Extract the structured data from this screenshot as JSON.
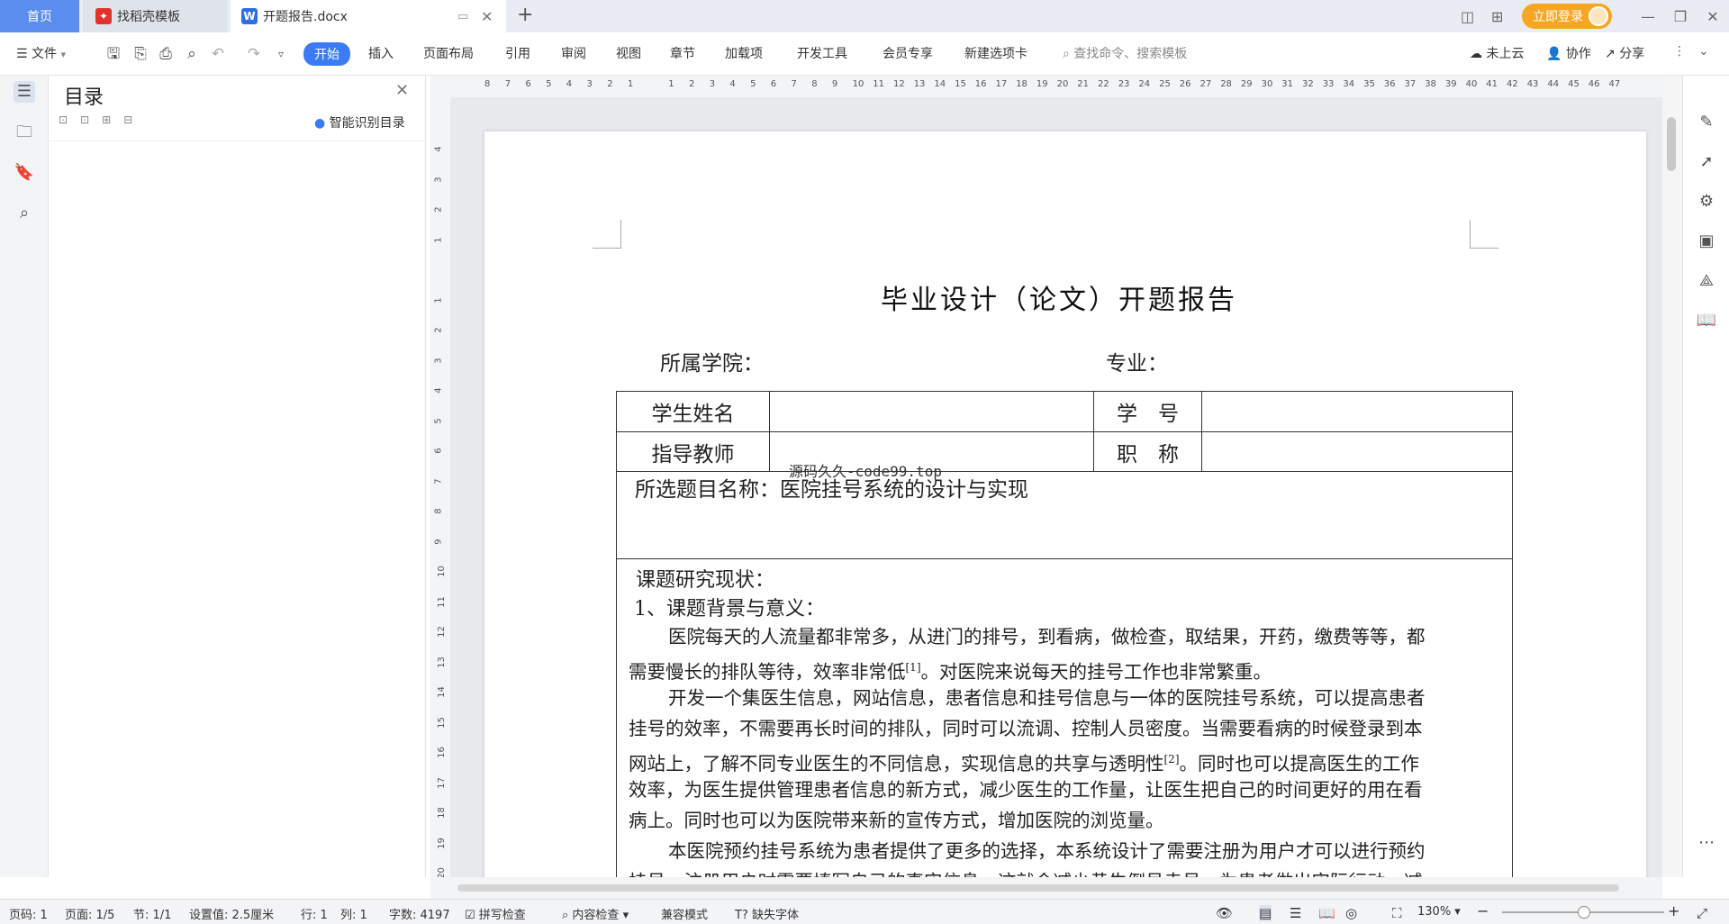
{
  "tabs": {
    "home": "首页",
    "templates": "找稻壳模板",
    "document": "开题报告.docx"
  },
  "titlebar": {
    "login": "立即登录"
  },
  "menu": {
    "file": "文件",
    "items": [
      "开始",
      "插入",
      "页面布局",
      "引用",
      "审阅",
      "视图",
      "章节",
      "加载项",
      "开发工具",
      "会员专享",
      "新建选项卡"
    ],
    "search_placeholder": "查找命令、搜索模板",
    "cloud": "未上云",
    "collab": "协作",
    "share": "分享"
  },
  "toc": {
    "title": "目录",
    "smart": "智能识别目录"
  },
  "ruler": {
    "h_ticks": [
      "8",
      "7",
      "6",
      "5",
      "4",
      "3",
      "2",
      "1",
      "",
      "1",
      "2",
      "3",
      "4",
      "5",
      "6",
      "7",
      "8",
      "9",
      "10",
      "11",
      "12",
      "13",
      "14",
      "15",
      "16",
      "17",
      "18",
      "19",
      "20",
      "21",
      "22",
      "23",
      "24",
      "25",
      "26",
      "27",
      "28",
      "29",
      "30",
      "31",
      "32",
      "33",
      "34",
      "35",
      "36",
      "37",
      "38",
      "39",
      "40",
      "41",
      "42",
      "43",
      "44",
      "45",
      "46",
      "47"
    ],
    "v_ticks": [
      "4",
      "3",
      "2",
      "1",
      "",
      "1",
      "2",
      "3",
      "4",
      "5",
      "6",
      "7",
      "8",
      "9",
      "10",
      "11",
      "12",
      "13",
      "14",
      "15",
      "16",
      "17",
      "18",
      "19",
      "20"
    ]
  },
  "doc": {
    "title": "毕业设计（论文）开题报告",
    "college": "所属学院：",
    "major": "专业：",
    "student_name": "学生姓名",
    "student_id": "学　号",
    "advisor": "指导教师",
    "rank": "职　称",
    "watermark": "源码久久-code99.top",
    "topic": "所选题目名称：医院挂号系统的设计与实现",
    "status_head": "课题研究现状：",
    "sub1": "1、课题背景与意义：",
    "p1a": "医院每天的人流量都非常多，从进门的排号，到看病，做检查，取结果，开药，缴费等等，都",
    "p1b": "需要慢长的排队等待，效率非常低",
    "p1b_ref": "[1]",
    "p1b_tail": "。对医院来说每天的挂号工作也非常繁重。",
    "p2a": "开发一个集医生信息，网站信息，患者信息和挂号信息与一体的医院挂号系统，可以提高患者",
    "p2b": "挂号的效率，不需要再长时间的排队，同时可以流调、控制人员密度。当需要看病的时候登录到本",
    "p2c": "网站上，了解不同专业医生的不同信息，实现信息的共享与透明性",
    "p2c_ref": "[2]",
    "p2c_tail": "。同时也可以提高医生的工作",
    "p2d": "效率，为医生提供管理患者信息的新方式，减少医生的工作量，让医生把自己的时间更好的用在看",
    "p2e": "病上。同时也可以为医院带来新的宣传方式，增加医院的浏览量。",
    "p3a": "本医院预约挂号系统为患者提供了更多的选择，本系统设计了需要注册为用户才可以进行预约",
    "p3b": "挂号，注册用户时需要填写自己的真实信息，这就会减少黄牛倒号卖号，为患者做出实际行动，减"
  },
  "status": {
    "page_no": "页码: 1",
    "pages": "页面: 1/5",
    "section": "节: 1/1",
    "setting": "设置值: 2.5厘米",
    "row": "行: 1",
    "col": "列: 1",
    "words": "字数: 4197",
    "spell": "拼写检查",
    "content": "内容检查",
    "compat": "兼容模式",
    "missing_font": "缺失字体",
    "zoom": "130%"
  }
}
